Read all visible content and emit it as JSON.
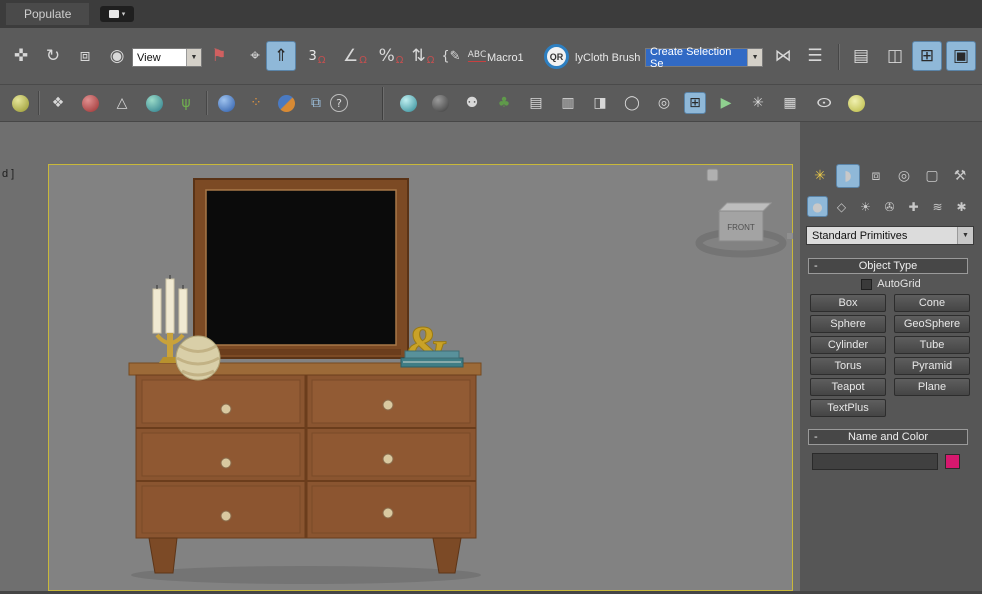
{
  "titlebar": {
    "populate_label": "Populate"
  },
  "toolbar_main": {
    "view_dropdown_value": "View",
    "snap_value": "3",
    "abc_label": "ABC",
    "macro_label": "Macro1",
    "qr_label": "QR",
    "polycloth_label": "lyCloth Brush",
    "selection_set_value": "Create Selection Se"
  },
  "viewport": {
    "clipped_label": "d ]",
    "viewcube_label": "FRONT"
  },
  "command_panel": {
    "primitives_dropdown_value": "Standard Primitives",
    "object_type_rollout": {
      "collapse_glyph": "-",
      "title": "Object Type",
      "autogrid_label": "AutoGrid",
      "buttons": [
        "Box",
        "Cone",
        "Sphere",
        "GeoSphere",
        "Cylinder",
        "Tube",
        "Torus",
        "Pyramid",
        "Teapot",
        "Plane",
        "TextPlus"
      ]
    },
    "name_color_rollout": {
      "collapse_glyph": "-",
      "title": "Name and Color",
      "name_value": "",
      "swatch_color": "#d6186e"
    }
  },
  "icons": {
    "move": "✜",
    "rotate": "↻",
    "scale": "⧈",
    "placement": "◉",
    "manipulate": "⚑",
    "pivot": "⌖",
    "snap_toggle": "⇑",
    "magnet": "Ω",
    "angle": "∠",
    "percent": "%",
    "spinner": "⇅",
    "brace": "{✎",
    "mirror": "⋈",
    "align": "☰",
    "layer_explorer": "▤",
    "scene_explorer": "◫",
    "curve_editor": "⊞",
    "material_editor": "▣",
    "dropdown_arrow": "▼",
    "dots_diamond": "❖",
    "pyramid": "△",
    "grass": "ψ",
    "cluster": "⁘",
    "copy_docs": "⧉",
    "help": "?",
    "biped": "⚉",
    "trees": "♣",
    "list": "▤",
    "bars": "▥",
    "door": "◨",
    "torus": "◯",
    "target": "◎",
    "box_arrows": "⊞",
    "play": "▶",
    "flower": "✳",
    "table": "▦",
    "eye": "⊙",
    "tab_create": "✳",
    "tab_modify": "◗",
    "tab_hierarchy": "⧈",
    "tab_motion": "◎",
    "tab_display": "▢",
    "tab_utilities": "⚒",
    "cat_geometry": "●",
    "cat_shapes": "◇",
    "cat_lights": "☀",
    "cat_cameras": "✇",
    "cat_helpers": "✚",
    "cat_spacewarps": "≋",
    "cat_systems": "✱"
  }
}
